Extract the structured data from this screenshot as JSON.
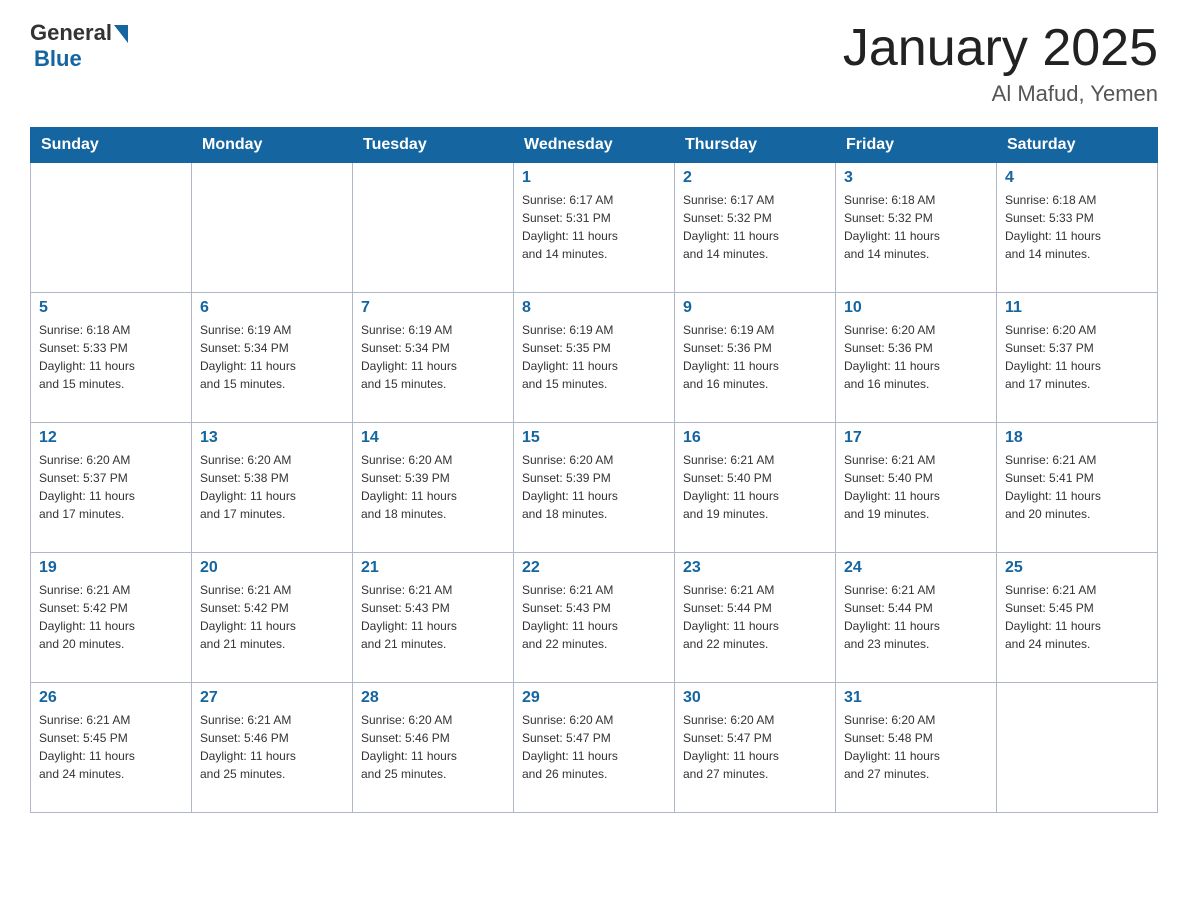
{
  "header": {
    "logo": {
      "general": "General",
      "blue": "Blue"
    },
    "title": "January 2025",
    "subtitle": "Al Mafud, Yemen"
  },
  "days_of_week": [
    "Sunday",
    "Monday",
    "Tuesday",
    "Wednesday",
    "Thursday",
    "Friday",
    "Saturday"
  ],
  "weeks": [
    [
      {
        "day": "",
        "info": ""
      },
      {
        "day": "",
        "info": ""
      },
      {
        "day": "",
        "info": ""
      },
      {
        "day": "1",
        "info": "Sunrise: 6:17 AM\nSunset: 5:31 PM\nDaylight: 11 hours\nand 14 minutes."
      },
      {
        "day": "2",
        "info": "Sunrise: 6:17 AM\nSunset: 5:32 PM\nDaylight: 11 hours\nand 14 minutes."
      },
      {
        "day": "3",
        "info": "Sunrise: 6:18 AM\nSunset: 5:32 PM\nDaylight: 11 hours\nand 14 minutes."
      },
      {
        "day": "4",
        "info": "Sunrise: 6:18 AM\nSunset: 5:33 PM\nDaylight: 11 hours\nand 14 minutes."
      }
    ],
    [
      {
        "day": "5",
        "info": "Sunrise: 6:18 AM\nSunset: 5:33 PM\nDaylight: 11 hours\nand 15 minutes."
      },
      {
        "day": "6",
        "info": "Sunrise: 6:19 AM\nSunset: 5:34 PM\nDaylight: 11 hours\nand 15 minutes."
      },
      {
        "day": "7",
        "info": "Sunrise: 6:19 AM\nSunset: 5:34 PM\nDaylight: 11 hours\nand 15 minutes."
      },
      {
        "day": "8",
        "info": "Sunrise: 6:19 AM\nSunset: 5:35 PM\nDaylight: 11 hours\nand 15 minutes."
      },
      {
        "day": "9",
        "info": "Sunrise: 6:19 AM\nSunset: 5:36 PM\nDaylight: 11 hours\nand 16 minutes."
      },
      {
        "day": "10",
        "info": "Sunrise: 6:20 AM\nSunset: 5:36 PM\nDaylight: 11 hours\nand 16 minutes."
      },
      {
        "day": "11",
        "info": "Sunrise: 6:20 AM\nSunset: 5:37 PM\nDaylight: 11 hours\nand 17 minutes."
      }
    ],
    [
      {
        "day": "12",
        "info": "Sunrise: 6:20 AM\nSunset: 5:37 PM\nDaylight: 11 hours\nand 17 minutes."
      },
      {
        "day": "13",
        "info": "Sunrise: 6:20 AM\nSunset: 5:38 PM\nDaylight: 11 hours\nand 17 minutes."
      },
      {
        "day": "14",
        "info": "Sunrise: 6:20 AM\nSunset: 5:39 PM\nDaylight: 11 hours\nand 18 minutes."
      },
      {
        "day": "15",
        "info": "Sunrise: 6:20 AM\nSunset: 5:39 PM\nDaylight: 11 hours\nand 18 minutes."
      },
      {
        "day": "16",
        "info": "Sunrise: 6:21 AM\nSunset: 5:40 PM\nDaylight: 11 hours\nand 19 minutes."
      },
      {
        "day": "17",
        "info": "Sunrise: 6:21 AM\nSunset: 5:40 PM\nDaylight: 11 hours\nand 19 minutes."
      },
      {
        "day": "18",
        "info": "Sunrise: 6:21 AM\nSunset: 5:41 PM\nDaylight: 11 hours\nand 20 minutes."
      }
    ],
    [
      {
        "day": "19",
        "info": "Sunrise: 6:21 AM\nSunset: 5:42 PM\nDaylight: 11 hours\nand 20 minutes."
      },
      {
        "day": "20",
        "info": "Sunrise: 6:21 AM\nSunset: 5:42 PM\nDaylight: 11 hours\nand 21 minutes."
      },
      {
        "day": "21",
        "info": "Sunrise: 6:21 AM\nSunset: 5:43 PM\nDaylight: 11 hours\nand 21 minutes."
      },
      {
        "day": "22",
        "info": "Sunrise: 6:21 AM\nSunset: 5:43 PM\nDaylight: 11 hours\nand 22 minutes."
      },
      {
        "day": "23",
        "info": "Sunrise: 6:21 AM\nSunset: 5:44 PM\nDaylight: 11 hours\nand 22 minutes."
      },
      {
        "day": "24",
        "info": "Sunrise: 6:21 AM\nSunset: 5:44 PM\nDaylight: 11 hours\nand 23 minutes."
      },
      {
        "day": "25",
        "info": "Sunrise: 6:21 AM\nSunset: 5:45 PM\nDaylight: 11 hours\nand 24 minutes."
      }
    ],
    [
      {
        "day": "26",
        "info": "Sunrise: 6:21 AM\nSunset: 5:45 PM\nDaylight: 11 hours\nand 24 minutes."
      },
      {
        "day": "27",
        "info": "Sunrise: 6:21 AM\nSunset: 5:46 PM\nDaylight: 11 hours\nand 25 minutes."
      },
      {
        "day": "28",
        "info": "Sunrise: 6:20 AM\nSunset: 5:46 PM\nDaylight: 11 hours\nand 25 minutes."
      },
      {
        "day": "29",
        "info": "Sunrise: 6:20 AM\nSunset: 5:47 PM\nDaylight: 11 hours\nand 26 minutes."
      },
      {
        "day": "30",
        "info": "Sunrise: 6:20 AM\nSunset: 5:47 PM\nDaylight: 11 hours\nand 27 minutes."
      },
      {
        "day": "31",
        "info": "Sunrise: 6:20 AM\nSunset: 5:48 PM\nDaylight: 11 hours\nand 27 minutes."
      },
      {
        "day": "",
        "info": ""
      }
    ]
  ]
}
